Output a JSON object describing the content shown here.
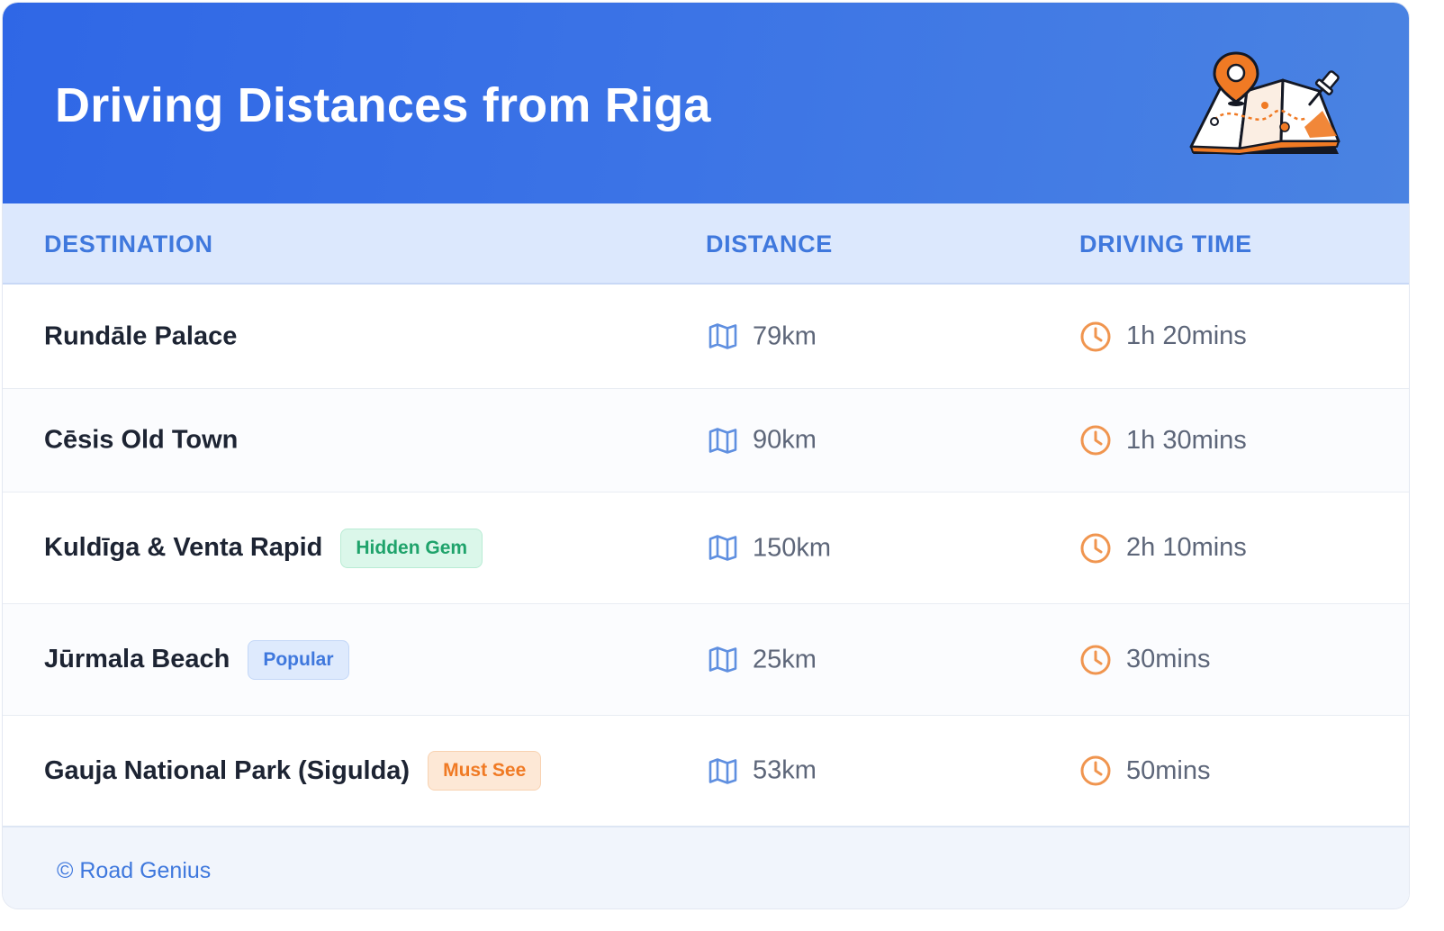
{
  "header": {
    "title": "Driving Distances from Riga",
    "illustration_icon": "map-pin-illustration"
  },
  "table": {
    "columns": [
      "DESTINATION",
      "DISTANCE",
      "DRIVING TIME"
    ],
    "rows": [
      {
        "destination": "Rundāle Palace",
        "badge": null,
        "distance": "79km",
        "time": "1h 20mins"
      },
      {
        "destination": "Cēsis Old Town",
        "badge": null,
        "distance": "90km",
        "time": "1h 30mins"
      },
      {
        "destination": "Kuldīga & Venta Rapid",
        "badge": "Hidden Gem",
        "distance": "150km",
        "time": "2h 10mins"
      },
      {
        "destination": "Jūrmala Beach",
        "badge": "Popular",
        "distance": "25km",
        "time": "30mins"
      },
      {
        "destination": "Gauja National Park (Sigulda)",
        "badge": "Must See",
        "distance": "53km",
        "time": "50mins"
      }
    ],
    "icons": {
      "distance": "map-icon",
      "time": "clock-icon"
    }
  },
  "footer": {
    "text": "© Road Genius"
  },
  "colors": {
    "header_start": "#2f67e6",
    "header_end": "#4a83e2",
    "accent_blue": "#3f78dd",
    "badge_green": "#1fa36b",
    "badge_orange": "#f07a24",
    "clock_orange": "#f0954f",
    "text_dark": "#1d2433",
    "text_muted": "#5d6679"
  }
}
